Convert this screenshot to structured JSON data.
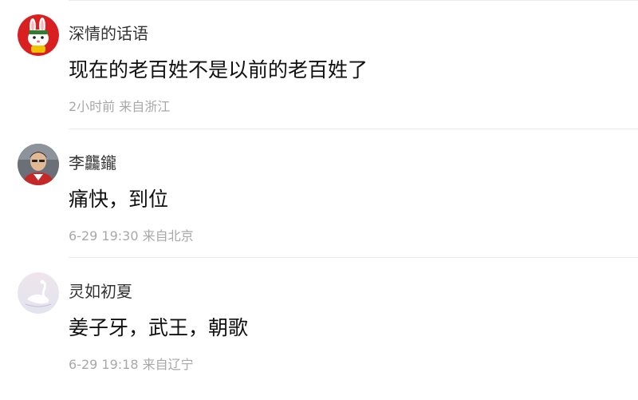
{
  "comments": [
    {
      "username": "深情的话语",
      "text": "现在的老百姓不是以前的老百姓了",
      "time": "2小时前",
      "location": "来自浙江",
      "avatar_icon": "rabbit-mascot-icon"
    },
    {
      "username": "李龘鑨",
      "text": "痛快，到位",
      "time": "6-29 19:30",
      "location": "来自北京",
      "avatar_icon": "person-photo-icon"
    },
    {
      "username": "灵如初夏",
      "text": "姜子牙，武王，朝歌",
      "time": "6-29 19:18",
      "location": "来自辽宁",
      "avatar_icon": "swan-icon"
    }
  ],
  "colors": {
    "username": "#333333",
    "text": "#111111",
    "meta": "#a8a8a8",
    "divider": "#ececec"
  }
}
